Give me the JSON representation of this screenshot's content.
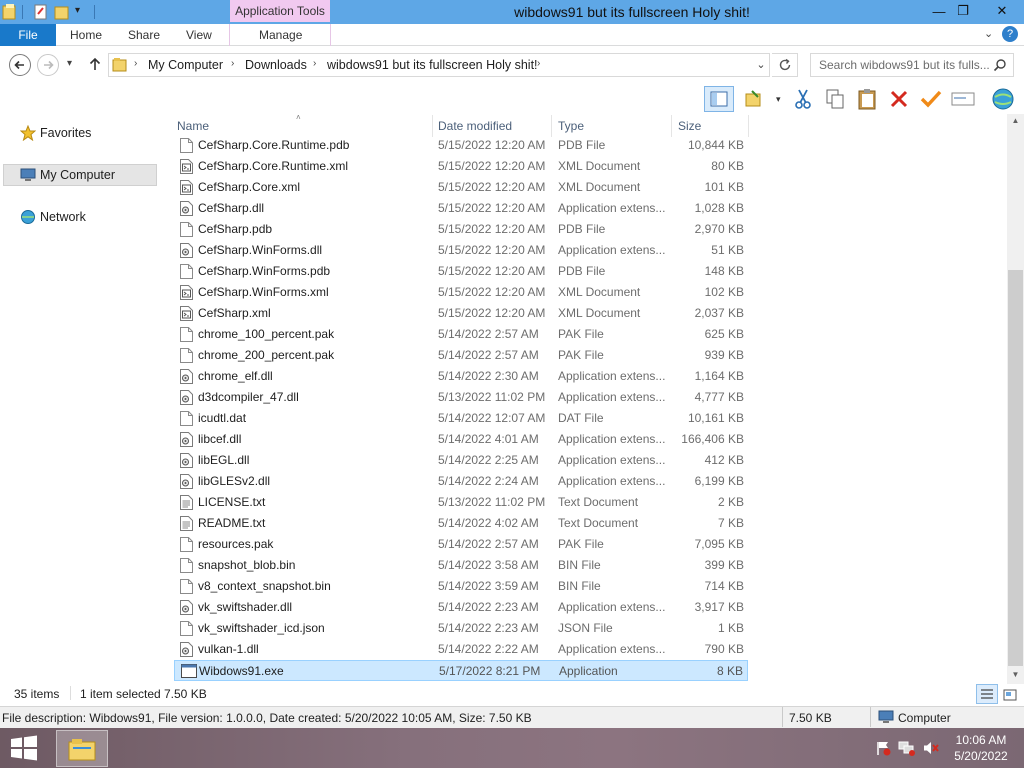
{
  "window": {
    "title": "wibdows91 but its fullscreen Holy shit!",
    "context_tab": "Application Tools",
    "controls": {
      "minimize": "—",
      "maximize": "❐",
      "close": "✕"
    }
  },
  "ribbon": {
    "file": "File",
    "tabs": [
      "Home",
      "Share",
      "View"
    ],
    "manage": "Manage",
    "help": "?"
  },
  "address": {
    "breadcrumbs": [
      "My Computer",
      "Downloads",
      "wibdows91 but its fullscreen Holy shit!"
    ],
    "search_placeholder": "Search wibdows91 but its fulls..."
  },
  "nav": {
    "favorites": "Favorites",
    "my_computer": "My Computer",
    "network": "Network"
  },
  "columns": {
    "name": "Name",
    "date": "Date modified",
    "type": "Type",
    "size": "Size"
  },
  "files": [
    {
      "name": "CefSharp.Core.Runtime.pdb",
      "date": "5/15/2022 12:20 AM",
      "type": "PDB File",
      "size": "10,844 KB",
      "icon": "blank"
    },
    {
      "name": "CefSharp.Core.Runtime.xml",
      "date": "5/15/2022 12:20 AM",
      "type": "XML Document",
      "size": "80 KB",
      "icon": "xml"
    },
    {
      "name": "CefSharp.Core.xml",
      "date": "5/15/2022 12:20 AM",
      "type": "XML Document",
      "size": "101 KB",
      "icon": "xml"
    },
    {
      "name": "CefSharp.dll",
      "date": "5/15/2022 12:20 AM",
      "type": "Application extens...",
      "size": "1,028 KB",
      "icon": "dll"
    },
    {
      "name": "CefSharp.pdb",
      "date": "5/15/2022 12:20 AM",
      "type": "PDB File",
      "size": "2,970 KB",
      "icon": "blank"
    },
    {
      "name": "CefSharp.WinForms.dll",
      "date": "5/15/2022 12:20 AM",
      "type": "Application extens...",
      "size": "51 KB",
      "icon": "dll"
    },
    {
      "name": "CefSharp.WinForms.pdb",
      "date": "5/15/2022 12:20 AM",
      "type": "PDB File",
      "size": "148 KB",
      "icon": "blank"
    },
    {
      "name": "CefSharp.WinForms.xml",
      "date": "5/15/2022 12:20 AM",
      "type": "XML Document",
      "size": "102 KB",
      "icon": "xml"
    },
    {
      "name": "CefSharp.xml",
      "date": "5/15/2022 12:20 AM",
      "type": "XML Document",
      "size": "2,037 KB",
      "icon": "xml"
    },
    {
      "name": "chrome_100_percent.pak",
      "date": "5/14/2022 2:57 AM",
      "type": "PAK File",
      "size": "625 KB",
      "icon": "blank"
    },
    {
      "name": "chrome_200_percent.pak",
      "date": "5/14/2022 2:57 AM",
      "type": "PAK File",
      "size": "939 KB",
      "icon": "blank"
    },
    {
      "name": "chrome_elf.dll",
      "date": "5/14/2022 2:30 AM",
      "type": "Application extens...",
      "size": "1,164 KB",
      "icon": "dll"
    },
    {
      "name": "d3dcompiler_47.dll",
      "date": "5/13/2022 11:02 PM",
      "type": "Application extens...",
      "size": "4,777 KB",
      "icon": "dll"
    },
    {
      "name": "icudtl.dat",
      "date": "5/14/2022 12:07 AM",
      "type": "DAT File",
      "size": "10,161 KB",
      "icon": "blank"
    },
    {
      "name": "libcef.dll",
      "date": "5/14/2022 4:01 AM",
      "type": "Application extens...",
      "size": "166,406 KB",
      "icon": "dll"
    },
    {
      "name": "libEGL.dll",
      "date": "5/14/2022 2:25 AM",
      "type": "Application extens...",
      "size": "412 KB",
      "icon": "dll"
    },
    {
      "name": "libGLESv2.dll",
      "date": "5/14/2022 2:24 AM",
      "type": "Application extens...",
      "size": "6,199 KB",
      "icon": "dll"
    },
    {
      "name": "LICENSE.txt",
      "date": "5/13/2022 11:02 PM",
      "type": "Text Document",
      "size": "2 KB",
      "icon": "txt"
    },
    {
      "name": "README.txt",
      "date": "5/14/2022 4:02 AM",
      "type": "Text Document",
      "size": "7 KB",
      "icon": "txt"
    },
    {
      "name": "resources.pak",
      "date": "5/14/2022 2:57 AM",
      "type": "PAK File",
      "size": "7,095 KB",
      "icon": "blank"
    },
    {
      "name": "snapshot_blob.bin",
      "date": "5/14/2022 3:58 AM",
      "type": "BIN File",
      "size": "399 KB",
      "icon": "blank"
    },
    {
      "name": "v8_context_snapshot.bin",
      "date": "5/14/2022 3:59 AM",
      "type": "BIN File",
      "size": "714 KB",
      "icon": "blank"
    },
    {
      "name": "vk_swiftshader.dll",
      "date": "5/14/2022 2:23 AM",
      "type": "Application extens...",
      "size": "3,917 KB",
      "icon": "dll"
    },
    {
      "name": "vk_swiftshader_icd.json",
      "date": "5/14/2022 2:23 AM",
      "type": "JSON File",
      "size": "1 KB",
      "icon": "blank"
    },
    {
      "name": "vulkan-1.dll",
      "date": "5/14/2022 2:22 AM",
      "type": "Application extens...",
      "size": "790 KB",
      "icon": "dll"
    },
    {
      "name": "Wibdows91.exe",
      "date": "5/17/2022 8:21 PM",
      "type": "Application",
      "size": "8 KB",
      "icon": "exe",
      "selected": true
    }
  ],
  "status": {
    "items": "35 items",
    "selected": "1 item selected",
    "selected_size": "7.50 KB"
  },
  "details": {
    "description": "File description: Wibdows91, File version: 1.0.0.0, Date created: 5/20/2022 10:05 AM, Size: 7.50 KB",
    "size": "7.50 KB",
    "location": "Computer"
  },
  "taskbar": {
    "time": "10:06 AM",
    "date": "5/20/2022"
  },
  "colors": {
    "titlebar": "#5ea7e6",
    "file_tab": "#1979ca",
    "selection": "#cce8ff",
    "app_tools": "#f1c9f0"
  }
}
